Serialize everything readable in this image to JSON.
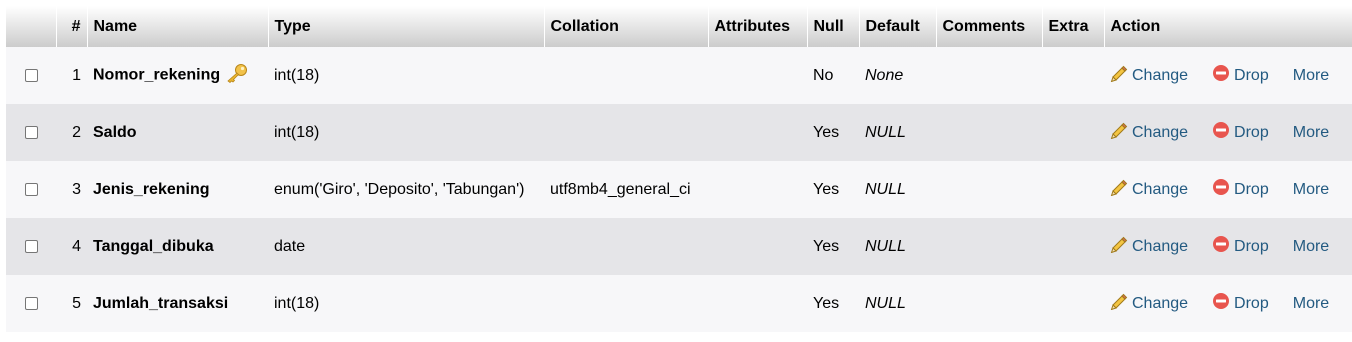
{
  "headers": {
    "num": "#",
    "name": "Name",
    "type": "Type",
    "collation": "Collation",
    "attributes": "Attributes",
    "null": "Null",
    "default": "Default",
    "comments": "Comments",
    "extra": "Extra",
    "action": "Action"
  },
  "actions": {
    "change": "Change",
    "drop": "Drop",
    "more": "More"
  },
  "colors": {
    "link": "#235a81",
    "row_odd": "#f7f7f9",
    "row_even": "#e5e5e8",
    "drop_icon": "#e8554e",
    "key_icon": "#e9b530"
  },
  "rows": [
    {
      "num": "1",
      "name": "Nomor_rekening",
      "primary_key": true,
      "type": "int(18)",
      "collation": "",
      "attributes": "",
      "null": "No",
      "default": "None",
      "comments": "",
      "extra": ""
    },
    {
      "num": "2",
      "name": "Saldo",
      "primary_key": false,
      "type": "int(18)",
      "collation": "",
      "attributes": "",
      "null": "Yes",
      "default": "NULL",
      "comments": "",
      "extra": ""
    },
    {
      "num": "3",
      "name": "Jenis_rekening",
      "primary_key": false,
      "type": "enum('Giro', 'Deposito', 'Tabungan')",
      "collation": "utf8mb4_general_ci",
      "attributes": "",
      "null": "Yes",
      "default": "NULL",
      "comments": "",
      "extra": ""
    },
    {
      "num": "4",
      "name": "Tanggal_dibuka",
      "primary_key": false,
      "type": "date",
      "collation": "",
      "attributes": "",
      "null": "Yes",
      "default": "NULL",
      "comments": "",
      "extra": ""
    },
    {
      "num": "5",
      "name": "Jumlah_transaksi",
      "primary_key": false,
      "type": "int(18)",
      "collation": "",
      "attributes": "",
      "null": "Yes",
      "default": "NULL",
      "comments": "",
      "extra": ""
    }
  ]
}
